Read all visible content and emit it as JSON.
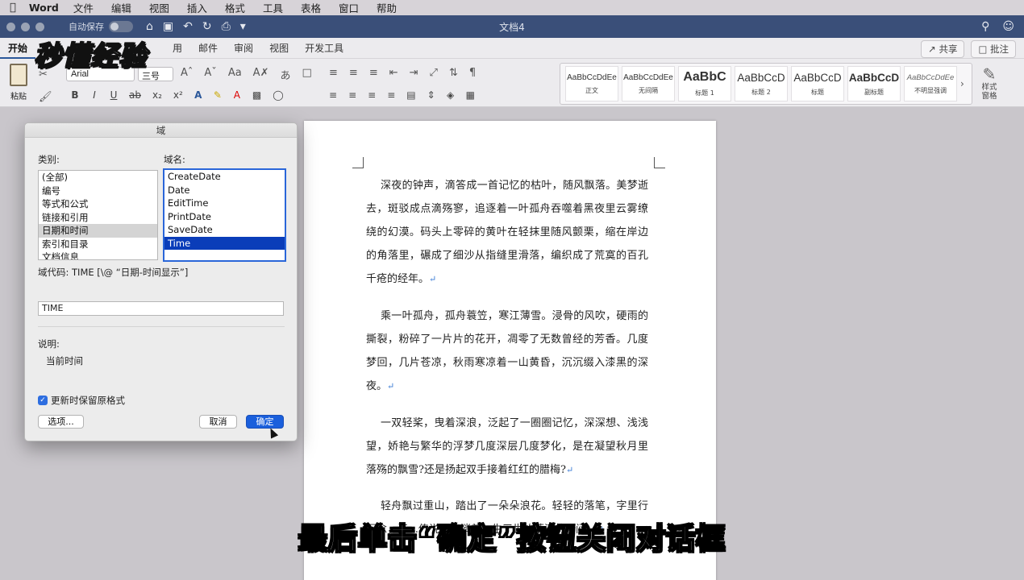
{
  "menubar": {
    "app": "Word",
    "items": [
      "文件",
      "编辑",
      "视图",
      "插入",
      "格式",
      "工具",
      "表格",
      "窗口",
      "帮助"
    ]
  },
  "titlebar": {
    "autosave": "自动保存",
    "doc_title": "文档4"
  },
  "ribbon_tabs": {
    "items": [
      "开始",
      "邮件",
      "审阅",
      "视图",
      "开发工具"
    ],
    "partial": "用",
    "share": "共享",
    "comment": "批注"
  },
  "ribbon": {
    "paste_label": "粘贴",
    "font_name": "Arial",
    "font_size": "三号",
    "styles": [
      {
        "sample": "AaBbCcDdEe",
        "name": "正文",
        "kind": "small"
      },
      {
        "sample": "AaBbCcDdEe",
        "name": "无间隔",
        "kind": "small"
      },
      {
        "sample": "AaBbC",
        "name": "标题 1",
        "kind": "big"
      },
      {
        "sample": "AaBbCcD",
        "name": "标题 2",
        "kind": "mid"
      },
      {
        "sample": "AaBbCcD",
        "name": "标题",
        "kind": "mid"
      },
      {
        "sample": "AaBbCcD",
        "name": "副标题",
        "kind": "mid"
      },
      {
        "sample": "AaBbCcDdEe",
        "name": "不明显强调",
        "kind": "italic"
      }
    ],
    "style_pane": "样式\n窗格"
  },
  "watermark_logo": "秒懂经验",
  "dialog": {
    "title": "域",
    "category_label": "类别:",
    "categories": [
      "(全部)",
      "编号",
      "等式和公式",
      "链接和引用",
      "日期和时间",
      "索引和目录",
      "文档信息"
    ],
    "selected_category": "日期和时间",
    "field_name_label": "域名:",
    "field_names": [
      "CreateDate",
      "Date",
      "EditTime",
      "PrintDate",
      "SaveDate",
      "Time"
    ],
    "selected_field": "Time",
    "field_code_label": "域代码: TIME [\\@ “日期-时间显示”]",
    "field_code_value": "TIME",
    "desc_label": "说明:",
    "desc_text": "当前时间",
    "preserve_label": "更新时保留原格式",
    "options_button": "选项...",
    "cancel_button": "取消",
    "ok_button": "确定"
  },
  "document": {
    "paragraphs": [
      "深夜的钟声，滴答成一首记忆的枯叶，随风飘落。美梦逝去，斑驳成点滴殇寥，追逐着一叶孤舟吞噬着黑夜里云雾缭绕的幻漠。码头上零碎的黄叶在轻抹里随风颤栗，缩在岸边的角落里，碾成了细沙从指缝里滑落，编织成了荒寞的百孔千疮的经年。",
      "乘一叶孤舟，孤舟蓑笠，寒江薄雪。浸骨的风吹，硬雨的撕裂，粉碎了一片片的花开，凋零了无数曾经的芳香。几度梦回，几片苍凉，秋雨寒凉着一山黄昏，沉沉缀入漆黑的深夜。",
      "一双轻桨，曳着深浪，泛起了一圈圈记忆，深深想、浅浅望，娇艳与繁华的浮梦几度深层几度梦化，是在凝望秋月里落殇的飘雪?还是扬起双手接着红红的腊梅?",
      "轻舟飘过重山，踏出了一朵朵浪花。轻轻的落笔，字里行间念，江…传说，流淌着一生三世的落漠的瞬间。"
    ]
  },
  "subtitle": "最后单击“确定”按钮关闭对话框"
}
